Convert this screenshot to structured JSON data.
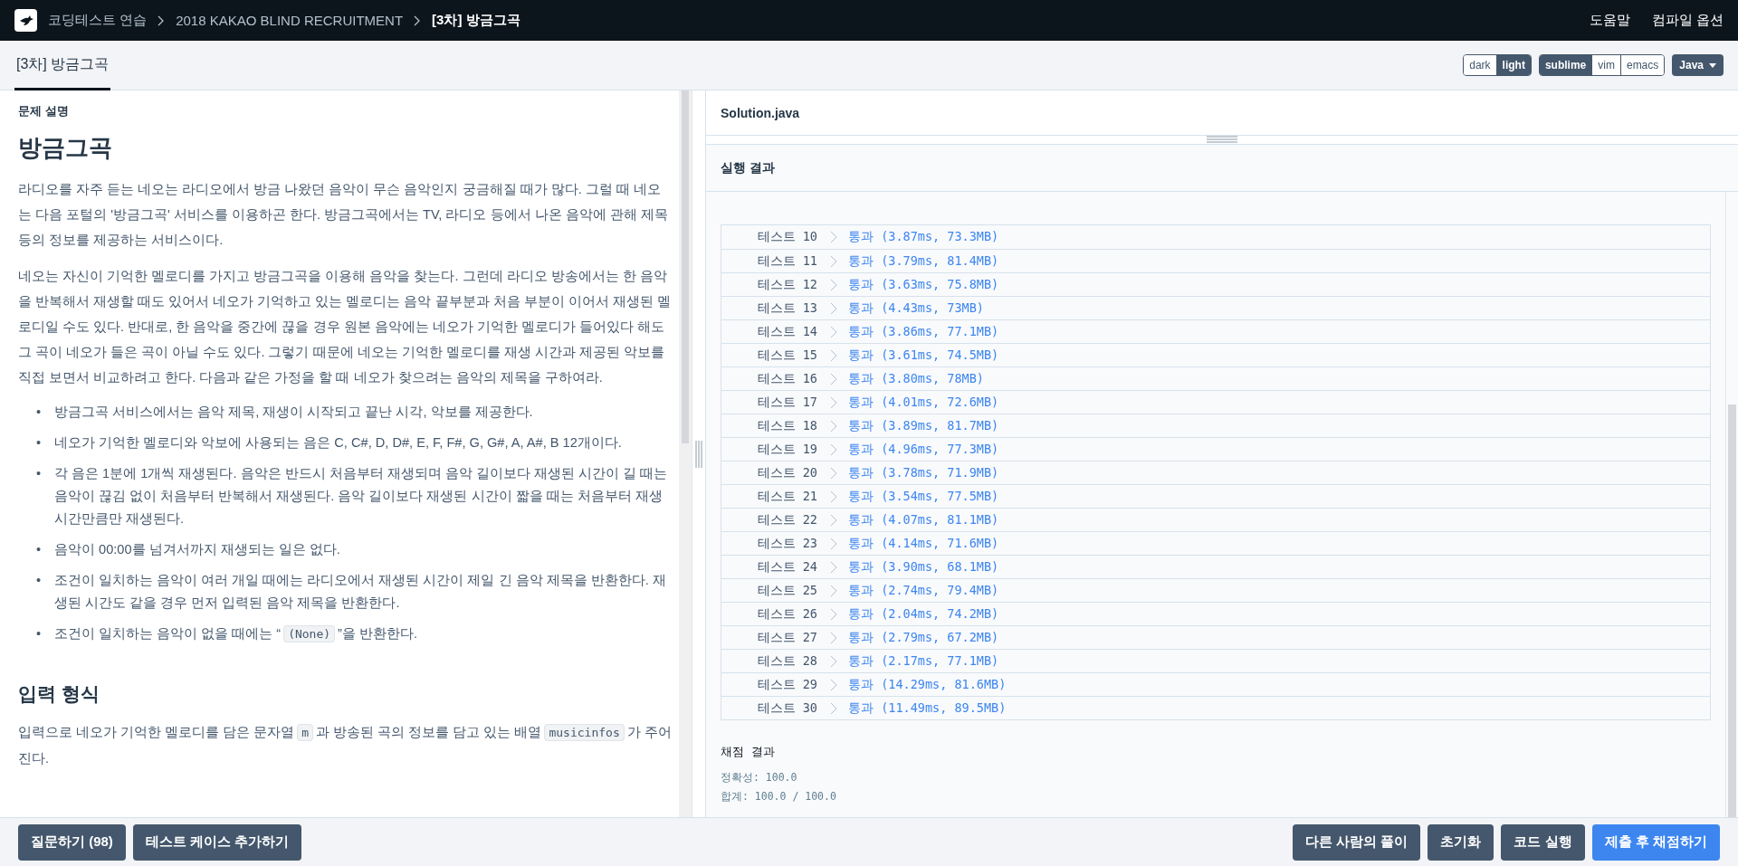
{
  "breadcrumbs": [
    {
      "label": "코딩테스트 연습",
      "current": false
    },
    {
      "label": "2018 KAKAO BLIND RECRUITMENT",
      "current": false
    },
    {
      "label": "[3차] 방금그곡",
      "current": true
    }
  ],
  "header_links": [
    "도움말",
    "컴파일 옵션"
  ],
  "tab": {
    "label": "[3차] 방금그곡",
    "selected": true
  },
  "theme_toggle": [
    {
      "label": "dark",
      "selected": false
    },
    {
      "label": "light",
      "selected": true
    }
  ],
  "keymap_toggle": [
    {
      "label": "sublime",
      "selected": true
    },
    {
      "label": "vim",
      "selected": false
    },
    {
      "label": "emacs",
      "selected": false
    }
  ],
  "language": "Java",
  "problem": {
    "section_label": "문제 설명",
    "title": "방금그곡",
    "paragraphs": [
      "라디오를 자주 듣는 네오는 라디오에서 방금 나왔던 음악이 무슨 음악인지 궁금해질 때가 많다. 그럴 때 네오는 다음 포털의 '방금그곡' 서비스를 이용하곤 한다. 방금그곡에서는 TV, 라디오 등에서 나온 음악에 관해 제목 등의 정보를 제공하는 서비스이다.",
      "네오는 자신이 기억한 멜로디를 가지고 방금그곡을 이용해 음악을 찾는다. 그런데 라디오 방송에서는 한 음악을 반복해서 재생할 때도 있어서 네오가 기억하고 있는 멜로디는 음악 끝부분과 처음 부분이 이어서 재생된 멜로디일 수도 있다. 반대로, 한 음악을 중간에 끊을 경우 원본 음악에는 네오가 기억한 멜로디가 들어있다 해도 그 곡이 네오가 들은 곡이 아닐 수도 있다. 그렇기 때문에 네오는 기억한 멜로디를 재생 시간과 제공된 악보를 직접 보면서 비교하려고 한다. 다음과 같은 가정을 할 때 네오가 찾으려는 음악의 제목을 구하여라."
    ],
    "bullets": [
      {
        "marker": "•",
        "segments": [
          {
            "kind": "text",
            "text": "방금그곡 서비스에서는 음악 제목, 재생이 시작되고 끝난 시각, 악보를 제공한다."
          }
        ]
      },
      {
        "marker": "•",
        "segments": [
          {
            "kind": "text",
            "text": "네오가 기억한 멜로디와 악보에 사용되는 음은 C, C#, D, D#, E, F, F#, G, G#, A, A#, B 12개이다."
          }
        ]
      },
      {
        "marker": "•",
        "segments": [
          {
            "kind": "text",
            "text": "각 음은 1분에 1개씩 재생된다. 음악은 반드시 처음부터 재생되며 음악 길이보다 재생된 시간이 길 때는 음악이 끊김 없이 처음부터 반복해서 재생된다. 음악 길이보다 재생된 시간이 짧을 때는 처음부터 재생 시간만큼만 재생된다."
          }
        ]
      },
      {
        "marker": "•",
        "segments": [
          {
            "kind": "text",
            "text": "음악이 00:00를 넘겨서까지 재생되는 일은 없다."
          }
        ]
      },
      {
        "marker": "•",
        "segments": [
          {
            "kind": "text",
            "text": "조건이 일치하는 음악이 여러 개일 때에는 라디오에서 재생된 시간이 제일 긴 음악 제목을 반환한다. 재생된 시간도 같을 경우 먼저 입력된 음악 제목을 반환한다."
          }
        ]
      },
      {
        "marker": "•",
        "segments": [
          {
            "kind": "text",
            "text": "조건이 일치하는 음악이 없을 때에는 “"
          },
          {
            "kind": "code",
            "text": "(None)"
          },
          {
            "kind": "text",
            "text": "”을 반환한다."
          }
        ]
      }
    ],
    "input_heading": "입력 형식",
    "input_paragraph": [
      {
        "kind": "text",
        "text": "입력으로 네오가 기억한 멜로디를 담은 문자열"
      },
      {
        "kind": "code",
        "text": "m"
      },
      {
        "kind": "text",
        "text": "과 방송된 곡의 정보를 담고 있는 배열"
      },
      {
        "kind": "code",
        "text": "musicinfos"
      },
      {
        "kind": "text",
        "text": "가 주어진다."
      }
    ]
  },
  "editor": {
    "filename": "Solution.java"
  },
  "results": {
    "title": "실행 결과",
    "rows": [
      {
        "label": "테스트 10",
        "result": "통과 (3.87ms, 73.3MB)"
      },
      {
        "label": "테스트 11",
        "result": "통과 (3.79ms, 81.4MB)"
      },
      {
        "label": "테스트 12",
        "result": "통과 (3.63ms, 75.8MB)"
      },
      {
        "label": "테스트 13",
        "result": "통과 (4.43ms, 73MB)"
      },
      {
        "label": "테스트 14",
        "result": "통과 (3.86ms, 77.1MB)"
      },
      {
        "label": "테스트 15",
        "result": "통과 (3.61ms, 74.5MB)"
      },
      {
        "label": "테스트 16",
        "result": "통과 (3.80ms, 78MB)"
      },
      {
        "label": "테스트 17",
        "result": "통과 (4.01ms, 72.6MB)"
      },
      {
        "label": "테스트 18",
        "result": "통과 (3.89ms, 81.7MB)"
      },
      {
        "label": "테스트 19",
        "result": "통과 (4.96ms, 77.3MB)"
      },
      {
        "label": "테스트 20",
        "result": "통과 (3.78ms, 71.9MB)"
      },
      {
        "label": "테스트 21",
        "result": "통과 (3.54ms, 77.5MB)"
      },
      {
        "label": "테스트 22",
        "result": "통과 (4.07ms, 81.1MB)"
      },
      {
        "label": "테스트 23",
        "result": "통과 (4.14ms, 71.6MB)"
      },
      {
        "label": "테스트 24",
        "result": "통과 (3.90ms, 68.1MB)"
      },
      {
        "label": "테스트 25",
        "result": "통과 (2.74ms, 79.4MB)"
      },
      {
        "label": "테스트 26",
        "result": "통과 (2.04ms, 74.2MB)"
      },
      {
        "label": "테스트 27",
        "result": "통과 (2.79ms, 67.2MB)"
      },
      {
        "label": "테스트 28",
        "result": "통과 (2.17ms, 77.1MB)"
      },
      {
        "label": "테스트 29",
        "result": "통과 (14.29ms, 81.6MB)"
      },
      {
        "label": "테스트 30",
        "result": "통과 (11.49ms, 89.5MB)"
      }
    ]
  },
  "grading": {
    "title": "채점 결과",
    "lines": [
      "정확성: 100.0",
      "합계: 100.0 / 100.0"
    ]
  },
  "left_buttons": [
    "질문하기 (98)",
    "테스트 케이스 추가하기"
  ],
  "right_buttons": [
    {
      "label": "다른 사람의 풀이",
      "kind": "secondary"
    },
    {
      "label": "초기화",
      "kind": "secondary"
    },
    {
      "label": "코드 실행",
      "kind": "secondary"
    },
    {
      "label": "제출 후 채점하기",
      "kind": "primary"
    }
  ]
}
